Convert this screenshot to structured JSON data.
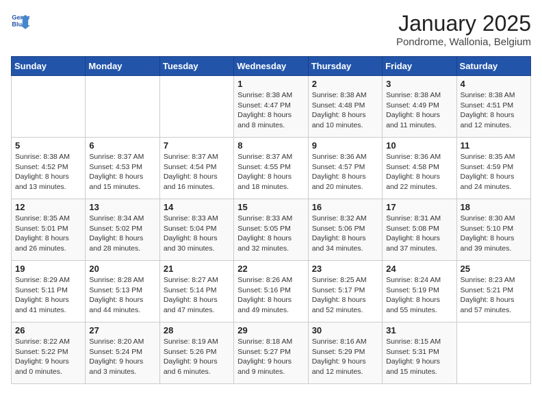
{
  "logo": {
    "line1": "General",
    "line2": "Blue"
  },
  "title": "January 2025",
  "subtitle": "Pondrome, Wallonia, Belgium",
  "headers": [
    "Sunday",
    "Monday",
    "Tuesday",
    "Wednesday",
    "Thursday",
    "Friday",
    "Saturday"
  ],
  "weeks": [
    [
      {
        "day": "",
        "info": ""
      },
      {
        "day": "",
        "info": ""
      },
      {
        "day": "",
        "info": ""
      },
      {
        "day": "1",
        "info": "Sunrise: 8:38 AM\nSunset: 4:47 PM\nDaylight: 8 hours\nand 8 minutes."
      },
      {
        "day": "2",
        "info": "Sunrise: 8:38 AM\nSunset: 4:48 PM\nDaylight: 8 hours\nand 10 minutes."
      },
      {
        "day": "3",
        "info": "Sunrise: 8:38 AM\nSunset: 4:49 PM\nDaylight: 8 hours\nand 11 minutes."
      },
      {
        "day": "4",
        "info": "Sunrise: 8:38 AM\nSunset: 4:51 PM\nDaylight: 8 hours\nand 12 minutes."
      }
    ],
    [
      {
        "day": "5",
        "info": "Sunrise: 8:38 AM\nSunset: 4:52 PM\nDaylight: 8 hours\nand 13 minutes."
      },
      {
        "day": "6",
        "info": "Sunrise: 8:37 AM\nSunset: 4:53 PM\nDaylight: 8 hours\nand 15 minutes."
      },
      {
        "day": "7",
        "info": "Sunrise: 8:37 AM\nSunset: 4:54 PM\nDaylight: 8 hours\nand 16 minutes."
      },
      {
        "day": "8",
        "info": "Sunrise: 8:37 AM\nSunset: 4:55 PM\nDaylight: 8 hours\nand 18 minutes."
      },
      {
        "day": "9",
        "info": "Sunrise: 8:36 AM\nSunset: 4:57 PM\nDaylight: 8 hours\nand 20 minutes."
      },
      {
        "day": "10",
        "info": "Sunrise: 8:36 AM\nSunset: 4:58 PM\nDaylight: 8 hours\nand 22 minutes."
      },
      {
        "day": "11",
        "info": "Sunrise: 8:35 AM\nSunset: 4:59 PM\nDaylight: 8 hours\nand 24 minutes."
      }
    ],
    [
      {
        "day": "12",
        "info": "Sunrise: 8:35 AM\nSunset: 5:01 PM\nDaylight: 8 hours\nand 26 minutes."
      },
      {
        "day": "13",
        "info": "Sunrise: 8:34 AM\nSunset: 5:02 PM\nDaylight: 8 hours\nand 28 minutes."
      },
      {
        "day": "14",
        "info": "Sunrise: 8:33 AM\nSunset: 5:04 PM\nDaylight: 8 hours\nand 30 minutes."
      },
      {
        "day": "15",
        "info": "Sunrise: 8:33 AM\nSunset: 5:05 PM\nDaylight: 8 hours\nand 32 minutes."
      },
      {
        "day": "16",
        "info": "Sunrise: 8:32 AM\nSunset: 5:06 PM\nDaylight: 8 hours\nand 34 minutes."
      },
      {
        "day": "17",
        "info": "Sunrise: 8:31 AM\nSunset: 5:08 PM\nDaylight: 8 hours\nand 37 minutes."
      },
      {
        "day": "18",
        "info": "Sunrise: 8:30 AM\nSunset: 5:10 PM\nDaylight: 8 hours\nand 39 minutes."
      }
    ],
    [
      {
        "day": "19",
        "info": "Sunrise: 8:29 AM\nSunset: 5:11 PM\nDaylight: 8 hours\nand 41 minutes."
      },
      {
        "day": "20",
        "info": "Sunrise: 8:28 AM\nSunset: 5:13 PM\nDaylight: 8 hours\nand 44 minutes."
      },
      {
        "day": "21",
        "info": "Sunrise: 8:27 AM\nSunset: 5:14 PM\nDaylight: 8 hours\nand 47 minutes."
      },
      {
        "day": "22",
        "info": "Sunrise: 8:26 AM\nSunset: 5:16 PM\nDaylight: 8 hours\nand 49 minutes."
      },
      {
        "day": "23",
        "info": "Sunrise: 8:25 AM\nSunset: 5:17 PM\nDaylight: 8 hours\nand 52 minutes."
      },
      {
        "day": "24",
        "info": "Sunrise: 8:24 AM\nSunset: 5:19 PM\nDaylight: 8 hours\nand 55 minutes."
      },
      {
        "day": "25",
        "info": "Sunrise: 8:23 AM\nSunset: 5:21 PM\nDaylight: 8 hours\nand 57 minutes."
      }
    ],
    [
      {
        "day": "26",
        "info": "Sunrise: 8:22 AM\nSunset: 5:22 PM\nDaylight: 9 hours\nand 0 minutes."
      },
      {
        "day": "27",
        "info": "Sunrise: 8:20 AM\nSunset: 5:24 PM\nDaylight: 9 hours\nand 3 minutes."
      },
      {
        "day": "28",
        "info": "Sunrise: 8:19 AM\nSunset: 5:26 PM\nDaylight: 9 hours\nand 6 minutes."
      },
      {
        "day": "29",
        "info": "Sunrise: 8:18 AM\nSunset: 5:27 PM\nDaylight: 9 hours\nand 9 minutes."
      },
      {
        "day": "30",
        "info": "Sunrise: 8:16 AM\nSunset: 5:29 PM\nDaylight: 9 hours\nand 12 minutes."
      },
      {
        "day": "31",
        "info": "Sunrise: 8:15 AM\nSunset: 5:31 PM\nDaylight: 9 hours\nand 15 minutes."
      },
      {
        "day": "",
        "info": ""
      }
    ]
  ]
}
